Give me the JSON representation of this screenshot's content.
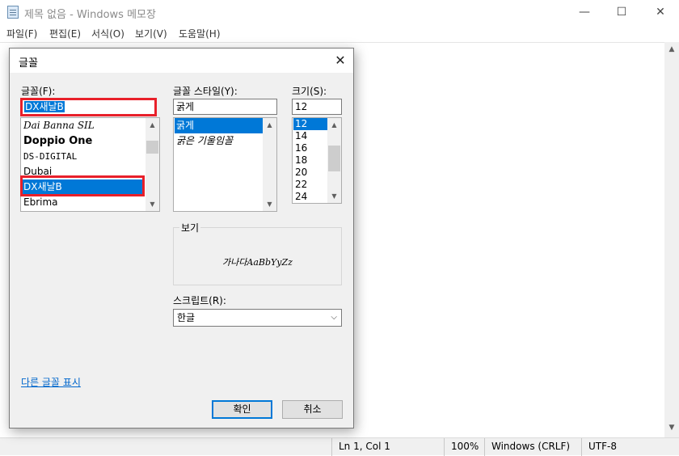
{
  "window": {
    "title": "제목 없음 - Windows 메모장",
    "minimize": "—",
    "maximize": "☐",
    "close": "✕"
  },
  "menu": [
    "파일(F)",
    "편집(E)",
    "서식(O)",
    "보기(V)",
    "도움말(H)"
  ],
  "statusbar": {
    "position": "Ln 1, Col 1",
    "zoom": "100%",
    "line_ending": "Windows (CRLF)",
    "encoding": "UTF-8"
  },
  "dialog": {
    "title": "글꼴",
    "close": "✕",
    "font": {
      "label": "글꼴(F):",
      "value": "DX새날B",
      "items": [
        "Dai Banna SIL",
        "Doppio One",
        "DS-DIGITAL",
        "Dubai",
        "DX새날B",
        "Ebrima"
      ],
      "selected_index": 4
    },
    "style": {
      "label": "글꼴 스타일(Y):",
      "value": "굵게",
      "items": [
        "굵게",
        "굵은 기울임꼴"
      ],
      "selected_index": 0
    },
    "size": {
      "label": "크기(S):",
      "value": "12",
      "items": [
        "12",
        "14",
        "16",
        "18",
        "20",
        "22",
        "24"
      ],
      "selected_index": 0
    },
    "sample": {
      "label": "보기",
      "text": "가나다AaBbYyZz"
    },
    "script": {
      "label": "스크립트(R):",
      "value": "한글"
    },
    "more_fonts_link": "다른 글꼴 표시",
    "ok": "확인",
    "cancel": "취소"
  },
  "colors": {
    "selection": "#0078d7",
    "highlight_box": "#e8202a",
    "link": "#0066cc"
  }
}
